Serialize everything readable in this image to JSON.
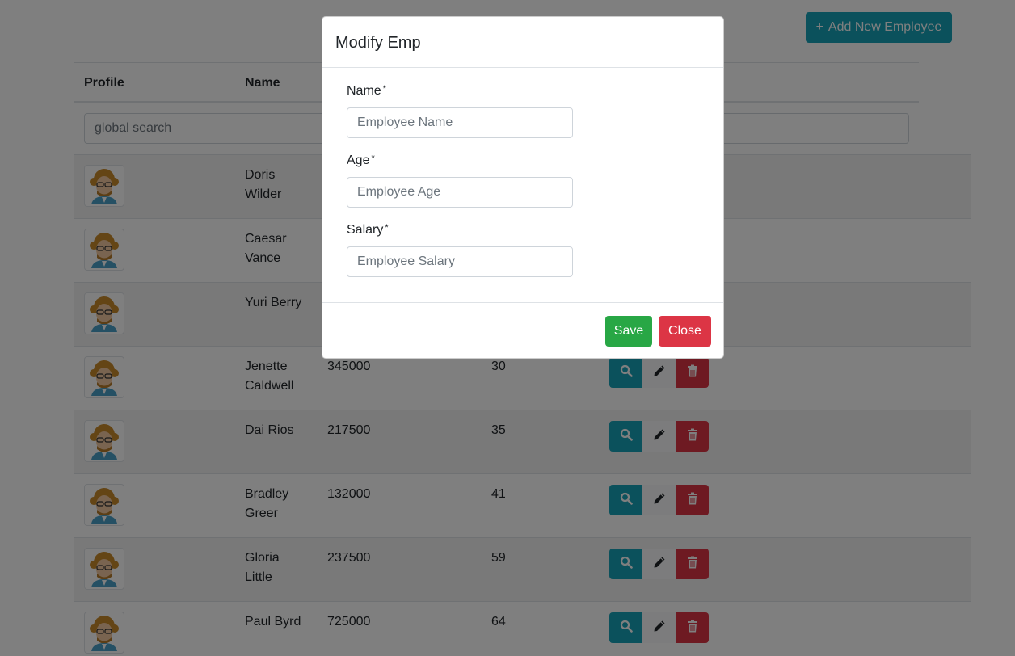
{
  "header": {
    "add_button_label": "Add New Employee",
    "add_icon": "plus-icon"
  },
  "table": {
    "columns": [
      "Profile",
      "Name"
    ],
    "search_placeholder": "global search",
    "rows": [
      {
        "name_line1": "Doris",
        "name_line2": "Wilder",
        "salary": "",
        "age": ""
      },
      {
        "name_line1": "Caesar",
        "name_line2": "Vance",
        "salary": "",
        "age": ""
      },
      {
        "name_line1": "Yuri Berry",
        "name_line2": "",
        "salary": "",
        "age": ""
      },
      {
        "name_line1": "Jenette",
        "name_line2": "Caldwell",
        "salary": "345000",
        "age": "30"
      },
      {
        "name_line1": "Dai Rios",
        "name_line2": "",
        "salary": "217500",
        "age": "35"
      },
      {
        "name_line1": "Bradley",
        "name_line2": "Greer",
        "salary": "132000",
        "age": "41"
      },
      {
        "name_line1": "Gloria",
        "name_line2": "Little",
        "salary": "237500",
        "age": "59"
      },
      {
        "name_line1": "Paul Byrd",
        "name_line2": "",
        "salary": "725000",
        "age": "64"
      }
    ],
    "action_icons": [
      "search-icon",
      "pencil-icon",
      "trash-icon"
    ]
  },
  "modal": {
    "title": "Modify Emp",
    "fields": [
      {
        "label": "Name",
        "required_mark": "*",
        "placeholder": "Employee Name",
        "value": ""
      },
      {
        "label": "Age",
        "required_mark": "*",
        "placeholder": "Employee Age",
        "value": ""
      },
      {
        "label": "Salary",
        "required_mark": "*",
        "placeholder": "Employee Salary",
        "value": ""
      }
    ],
    "save_label": "Save",
    "close_label": "Close"
  },
  "colors": {
    "info": "#17a2b8",
    "success": "#28a745",
    "danger": "#dc3545",
    "backdrop": "rgba(0,0,0,0.5)"
  }
}
